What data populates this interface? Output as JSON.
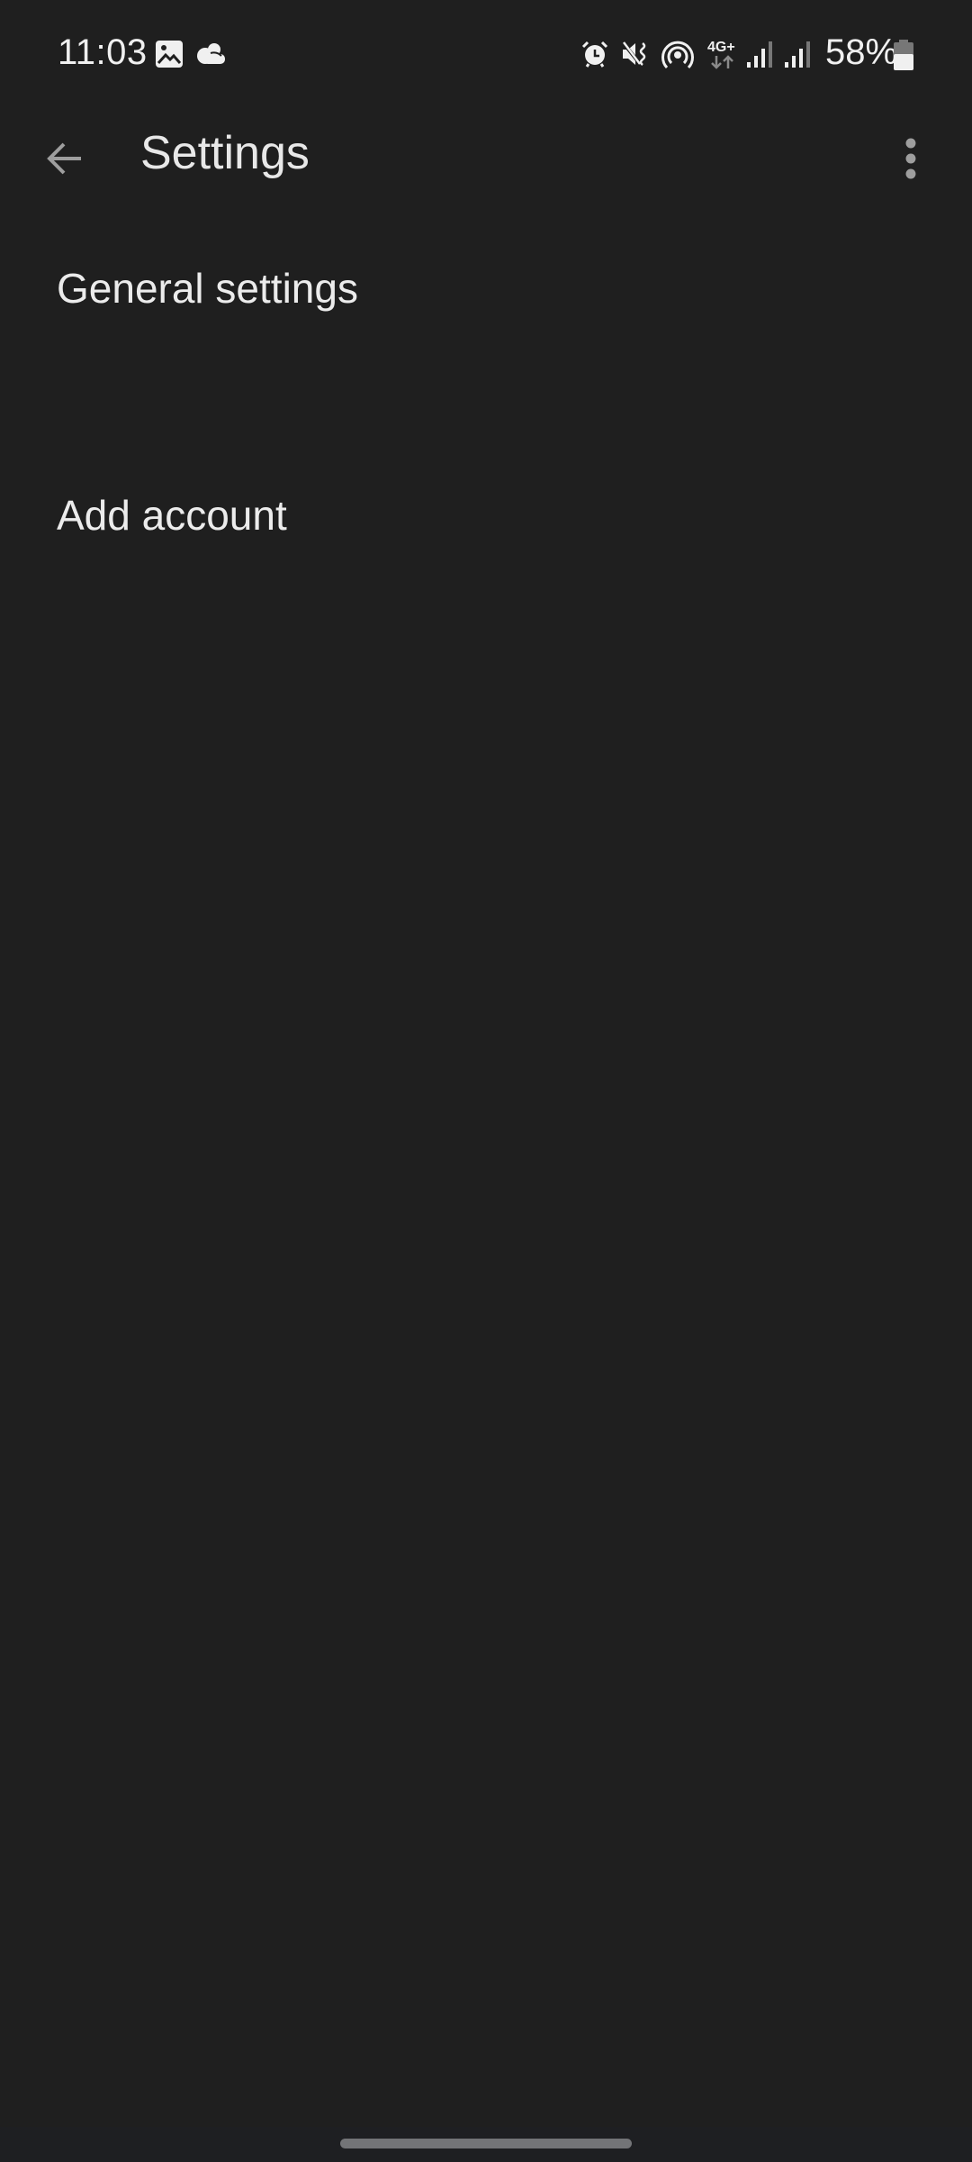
{
  "status_bar": {
    "time": "11:03",
    "left_icons": [
      "gallery-icon",
      "cloud-icon"
    ],
    "right_icons": [
      "alarm-icon",
      "mute-vibrate-icon",
      "hotspot-icon",
      "4g-plus-data-icon",
      "signal-icon-sim1",
      "signal-icon-sim2",
      "battery-icon"
    ],
    "network_label": "4G+",
    "battery_percent": "58%",
    "battery_level": 0.58
  },
  "app_bar": {
    "back_icon": "arrow-back-icon",
    "title": "Settings",
    "overflow_icon": "more-vert-icon"
  },
  "settings_list": {
    "items": [
      {
        "label": "General settings"
      },
      {
        "label": "Add account"
      }
    ]
  },
  "nav_bar": {
    "handle": "gesture-handle"
  },
  "colors": {
    "background": "#1f1f1f",
    "text_primary": "#ececec",
    "icon_muted": "#9e9e9e",
    "nav_handle": "#737477"
  }
}
